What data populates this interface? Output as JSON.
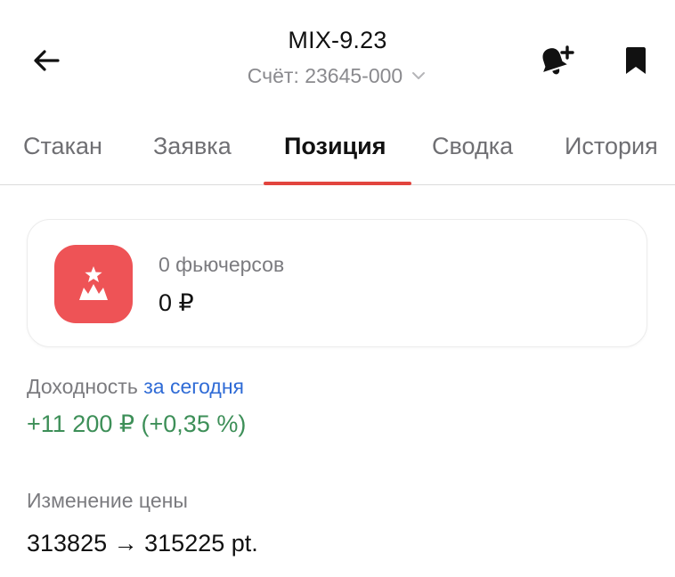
{
  "header": {
    "title": "MIX-9.23",
    "account_label": "Счёт: 23645-000",
    "icons": {
      "back": "arrow-left-icon",
      "account_dropdown": "chevron-down-icon",
      "alert": "bell-plus-icon",
      "bookmark": "bookmark-icon"
    }
  },
  "tabs": [
    {
      "label": "Стакан",
      "active": false
    },
    {
      "label": "Заявка",
      "active": false
    },
    {
      "label": "Позиция",
      "active": true
    },
    {
      "label": "Сводка",
      "active": false
    },
    {
      "label": "История",
      "active": false
    }
  ],
  "position_card": {
    "logo_icon": "crown-star-logo-icon",
    "quantity": "0 фьючерсов",
    "value": "0 ₽"
  },
  "yield": {
    "label": "Доходность",
    "period": "за сегодня",
    "value": "+11 200 ₽ (+0,35 %)"
  },
  "price_change": {
    "label": "Изменение цены",
    "from": "313825",
    "arrow": "→",
    "to": "315225 pt."
  },
  "colors": {
    "accent_red": "#e2443e",
    "logo_bg": "#ee5356",
    "positive_green": "#3d8f58",
    "link_blue": "#2f6bd6"
  }
}
